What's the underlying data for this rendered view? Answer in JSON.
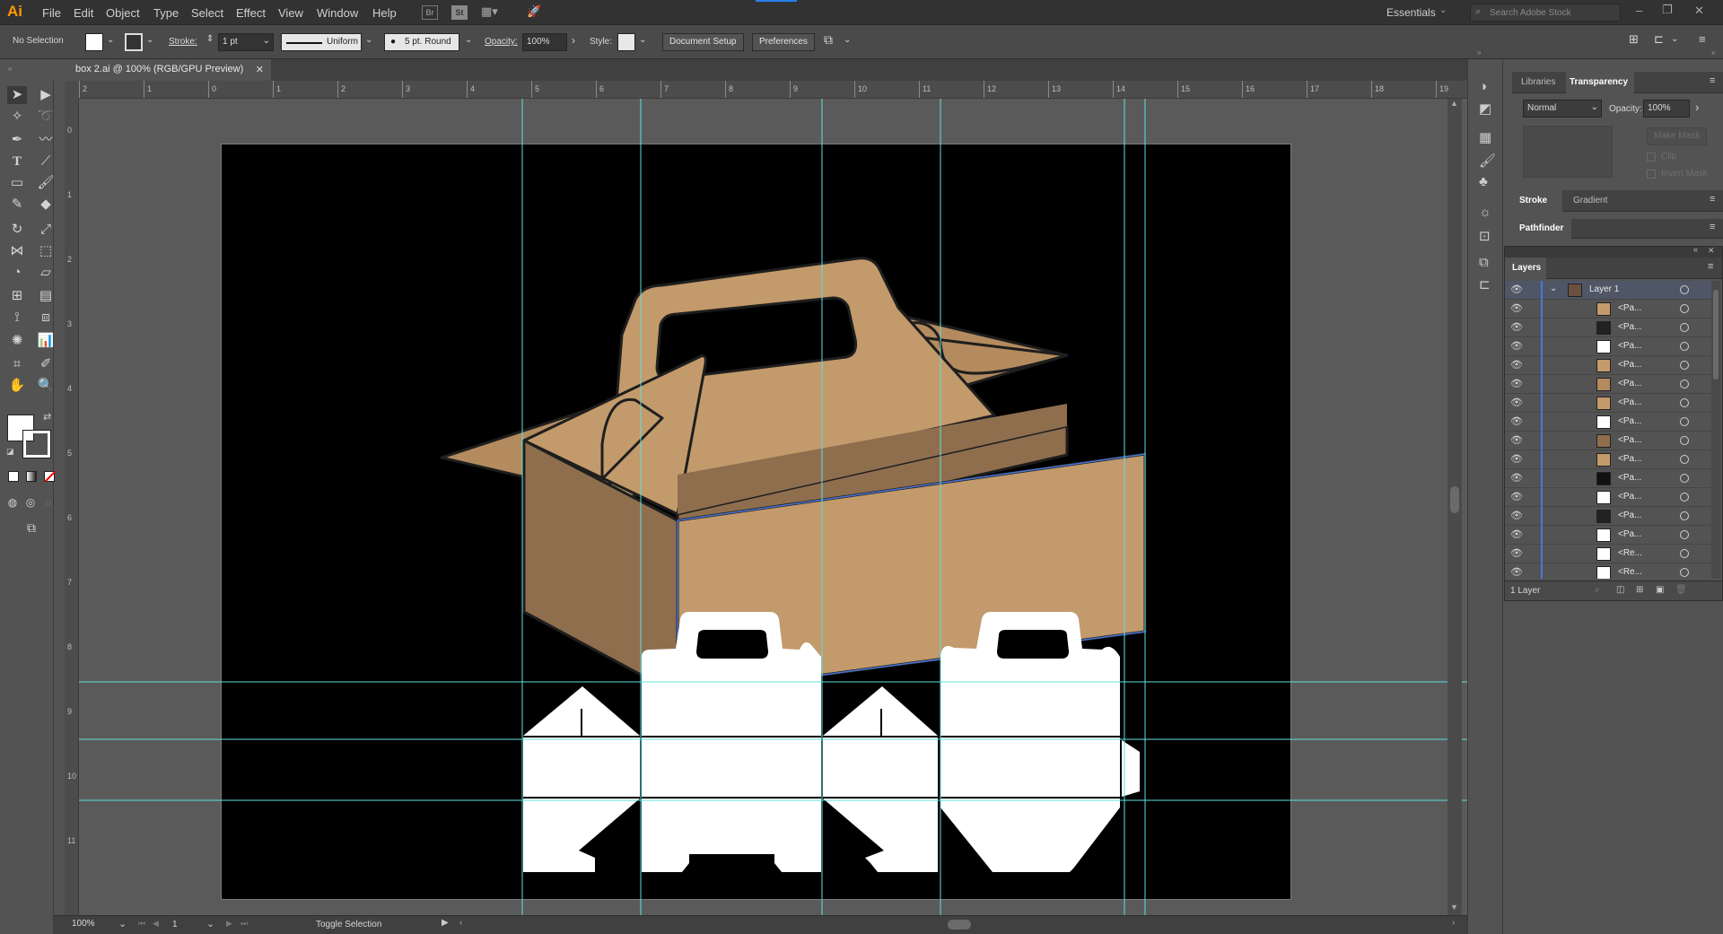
{
  "app": {
    "logo": "Ai",
    "menus": [
      "File",
      "Edit",
      "Object",
      "Type",
      "Select",
      "Effect",
      "View",
      "Window",
      "Help"
    ],
    "workspace": "Essentials",
    "search_placeholder": "Search Adobe Stock",
    "br_label": "Br",
    "st_label": "St"
  },
  "control_bar": {
    "selection": "No Selection",
    "stroke_label": "Stroke:",
    "stroke_weight": "1 pt",
    "profile": "Uniform",
    "brush": "5 pt. Round",
    "opacity_label": "Opacity:",
    "opacity": "100%",
    "style_label": "Style:",
    "document_setup": "Document Setup",
    "preferences": "Preferences"
  },
  "document": {
    "tab_title": "box 2.ai @ 100% (RGB/GPU Preview)",
    "ruler_top": [
      "2",
      "1",
      "0",
      "1",
      "2",
      "3",
      "4",
      "5",
      "6",
      "7",
      "8",
      "9",
      "10",
      "11",
      "12",
      "13",
      "14",
      "15",
      "16",
      "17",
      "18",
      "19"
    ],
    "ruler_left": [
      "0",
      "1",
      "2",
      "3",
      "4",
      "5",
      "6",
      "7",
      "8",
      "9",
      "10",
      "11"
    ]
  },
  "status": {
    "zoom": "100%",
    "artboard": "1",
    "mode": "Toggle Selection"
  },
  "panels": {
    "tab_libraries": "Libraries",
    "tab_transparency": "Transparency",
    "blend_mode": "Normal",
    "opacity_label": "Opacity:",
    "opacity_value": "100%",
    "make_mask": "Make Mask",
    "clip": "Clip",
    "invert_mask": "Invert Mask",
    "tab_stroke": "Stroke",
    "tab_gradient": "Gradient",
    "tab_pathfinder": "Pathfinder"
  },
  "layers": {
    "title": "Layers",
    "top_layer": "Layer 1",
    "items": [
      "<Pa...",
      "<Pa...",
      "<Pa...",
      "<Pa...",
      "<Pa...",
      "<Pa...",
      "<Pa...",
      "<Pa...",
      "<Pa...",
      "<Pa...",
      "<Pa...",
      "<Pa...",
      "<Pa...",
      "<Re...",
      "<Re..."
    ],
    "footer": "1 Layer"
  },
  "colors": {
    "box_front": "#c39a6b",
    "box_side": "#8f6e4e",
    "box_top": "#b48b5e",
    "guide": "#5ee0e0",
    "accent_orange": "#ff9a00",
    "selection_blue": "#4a76d8"
  }
}
